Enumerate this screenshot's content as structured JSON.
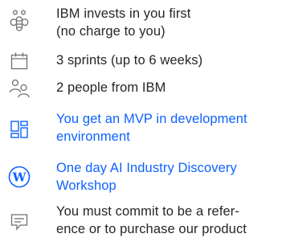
{
  "colors": {
    "text": "#262626",
    "link": "#0f62fe",
    "icon_gray": "#6f6f6f",
    "icon_blue": "#0f62fe"
  },
  "items": [
    {
      "icon": "bee-icon",
      "lines": [
        "IBM invests in you first",
        "(no charge to you)"
      ],
      "highlight": false
    },
    {
      "icon": "calendar-icon",
      "lines": [
        "3 sprints (up to 6 weeks)"
      ],
      "highlight": false
    },
    {
      "icon": "people-icon",
      "lines": [
        "2 people from IBM"
      ],
      "highlight": false
    },
    {
      "icon": "dashboard-icon",
      "lines": [
        "You get an MVP in development",
        "environment"
      ],
      "highlight": true
    },
    {
      "icon": "watson-w-icon",
      "lines": [
        "One day AI Industry Discovery",
        "Workshop"
      ],
      "highlight": true
    },
    {
      "icon": "chat-icon",
      "lines": [
        "You must commit to be a refer-",
        "ence or to purchase our product"
      ],
      "highlight": false
    }
  ]
}
